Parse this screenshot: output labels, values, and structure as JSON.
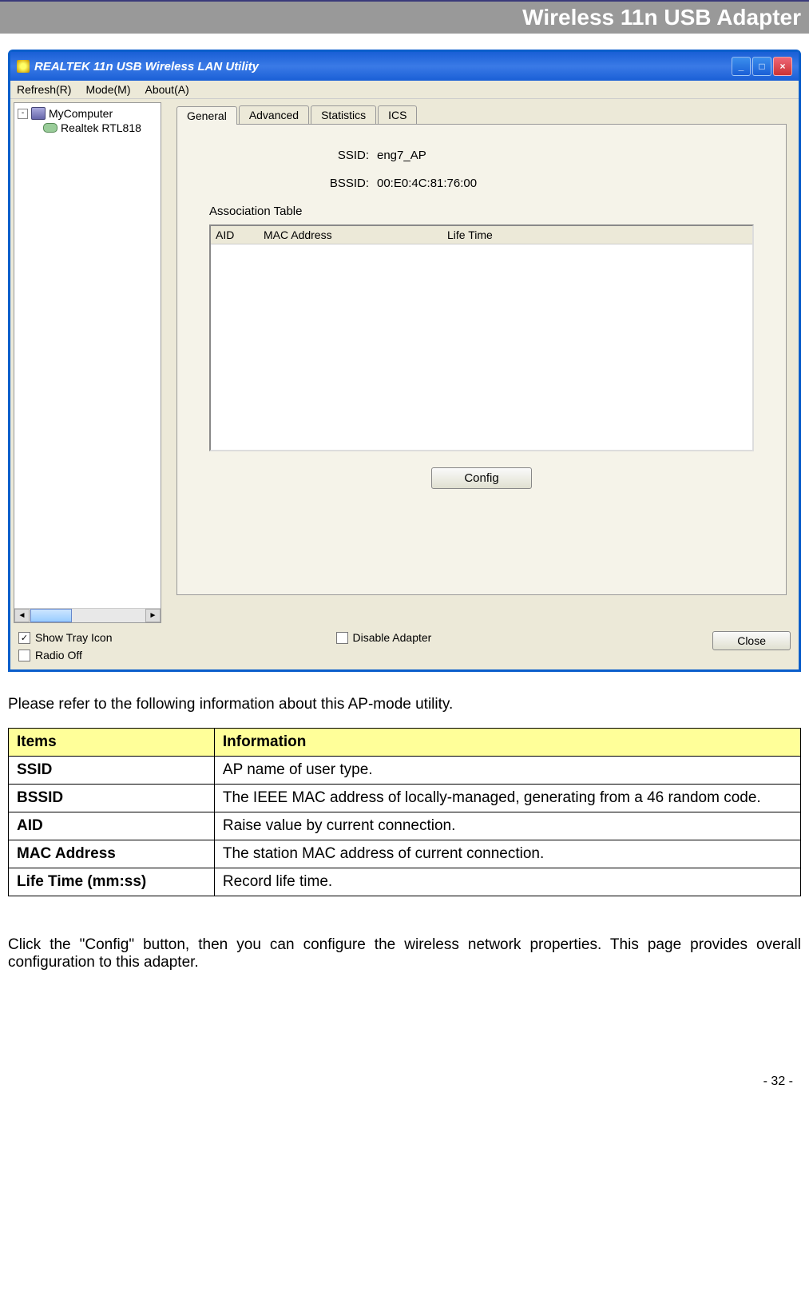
{
  "header": {
    "title": "Wireless 11n USB Adapter"
  },
  "window": {
    "title": "REALTEK 11n USB Wireless LAN Utility",
    "menu": {
      "refresh": "Refresh(R)",
      "mode": "Mode(M)",
      "about": "About(A)"
    },
    "tree": {
      "root": "MyComputer",
      "child": "Realtek RTL818"
    },
    "tabs": {
      "general": "General",
      "advanced": "Advanced",
      "statistics": "Statistics",
      "ics": "ICS"
    },
    "fields": {
      "ssid_label": "SSID:",
      "ssid_value": "eng7_AP",
      "bssid_label": "BSSID:",
      "bssid_value": "00:E0:4C:81:76:00",
      "assoc_label": "Association Table"
    },
    "table_headers": {
      "aid": "AID",
      "mac": "MAC Address",
      "life": "Life Time"
    },
    "config_button": "Config",
    "checkboxes": {
      "show_tray": "Show Tray Icon",
      "radio_off": "Radio Off",
      "disable_adapter": "Disable Adapter"
    },
    "close_button": "Close"
  },
  "body": {
    "intro": "Please refer to the following information about this AP-mode utility.",
    "table": {
      "header_items": "Items",
      "header_info": "Information",
      "rows": [
        {
          "item": "SSID",
          "info": "AP name of user type."
        },
        {
          "item": "BSSID",
          "info": "The IEEE MAC address of locally-managed, generating from a 46 random code."
        },
        {
          "item": "AID",
          "info": "Raise value by current connection."
        },
        {
          "item": "MAC Address",
          "info": "The station MAC address of current connection."
        },
        {
          "item": "Life Time (mm:ss)",
          "info": "Record life time."
        }
      ]
    },
    "para2": "Click the \"Config\" button, then you can configure the wireless network properties. This page provides overall configuration to this adapter."
  },
  "page_number": "- 32 -"
}
